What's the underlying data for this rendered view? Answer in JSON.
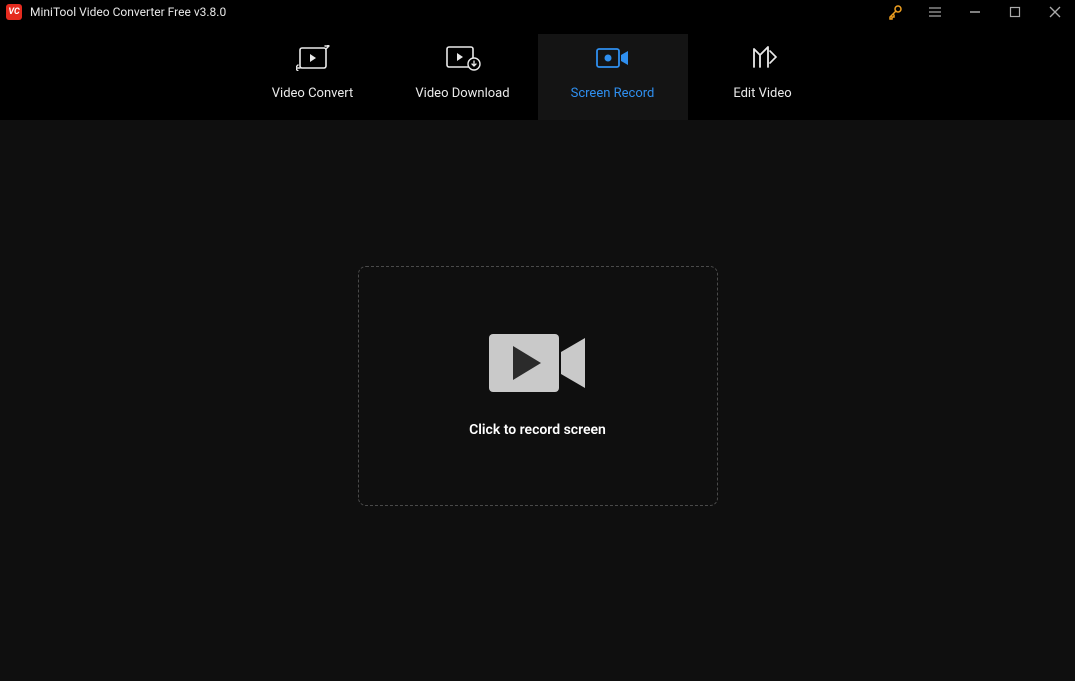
{
  "app": {
    "title": "MiniTool Video Converter Free v3.8.0"
  },
  "tabs": {
    "convert": "Video Convert",
    "download": "Video Download",
    "record": "Screen Record",
    "edit": "Edit Video"
  },
  "main": {
    "record_prompt": "Click to record screen"
  }
}
